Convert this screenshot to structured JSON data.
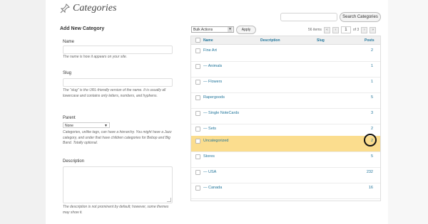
{
  "header": {
    "title": "Categories",
    "search_button": "Search Categories"
  },
  "form": {
    "title": "Add New Category",
    "name_label": "Name",
    "name_help": "The name is how it appears on your site.",
    "slug_label": "Slug",
    "slug_help": "The “slug” is the URL-friendly version of the name. It is usually all lowercase and contains only letters, numbers, and hyphens.",
    "parent_label": "Parent",
    "parent_value": "None",
    "parent_help": "Categories, unlike tags, can have a hierarchy. You might have a Jazz category, and under that have children categories for Bebop and Big Band. Totally optional.",
    "description_label": "Description",
    "description_help": "The description is not prominent by default; however, some themes may show it."
  },
  "toolbar": {
    "bulk_actions": "Bulk Actions",
    "apply": "Apply",
    "items_count": "56 items",
    "first": "«",
    "prev": "‹",
    "page": "1",
    "of_pages": "of 3",
    "next": "›",
    "last": "»"
  },
  "table": {
    "columns": {
      "name": "Name",
      "description": "Description",
      "slug": "Slug",
      "posts": "Posts"
    },
    "rows": [
      {
        "name": "Fine Art",
        "posts": "2"
      },
      {
        "name": "— Animals",
        "posts": "1"
      },
      {
        "name": "— Flowers",
        "posts": "1"
      },
      {
        "name": "Rapergoods",
        "posts": "5"
      },
      {
        "name": "— Single NoteCards",
        "posts": "3"
      },
      {
        "name": "— Sets",
        "posts": "2"
      },
      {
        "name": "Uncategorized",
        "posts": "2"
      },
      {
        "name": "Stores",
        "posts": "5"
      },
      {
        "name": "— USA",
        "posts": "232"
      },
      {
        "name": "— Canada",
        "posts": "16"
      }
    ]
  },
  "colors": {
    "link": "#21759b",
    "highlight_row": "#fbdd8e"
  }
}
